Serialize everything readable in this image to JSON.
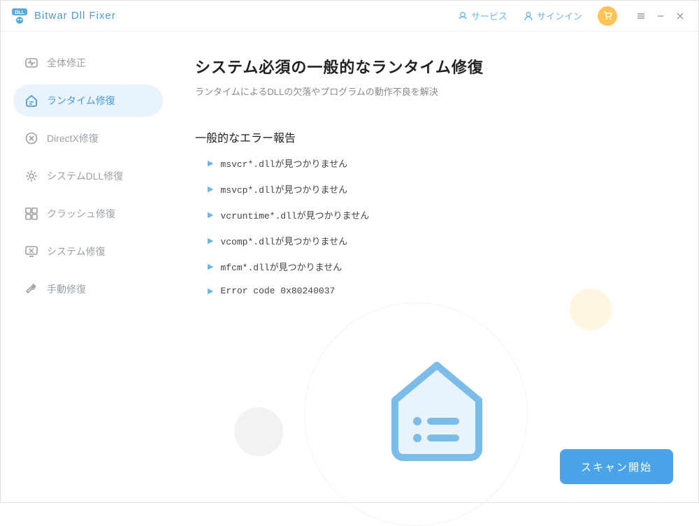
{
  "titlebar": {
    "app_name": "Bitwar Dll Fixer",
    "service_label": "サービス",
    "signin_label": "サインイン"
  },
  "sidebar": {
    "items": [
      {
        "label": "全体修正"
      },
      {
        "label": "ランタイム修復"
      },
      {
        "label": "DirectX修復"
      },
      {
        "label": "システムDLL修復"
      },
      {
        "label": "クラッシュ修復"
      },
      {
        "label": "システム修復"
      },
      {
        "label": "手動修復"
      }
    ]
  },
  "main": {
    "heading": "システム必須の一般的なランタイム修復",
    "subtitle": "ランタイムによるDLLの欠落やプログラムの動作不良を解決",
    "section_title": "一般的なエラー報告",
    "errors": [
      "msvcr*.dllが見つかりません",
      "msvcp*.dllが見つかりません",
      "vcruntime*.dllが見つかりません",
      "vcomp*.dllが見つかりません",
      "mfcm*.dllが見つかりません",
      "Error code 0x80240037"
    ],
    "scan_button": "スキャン開始"
  }
}
